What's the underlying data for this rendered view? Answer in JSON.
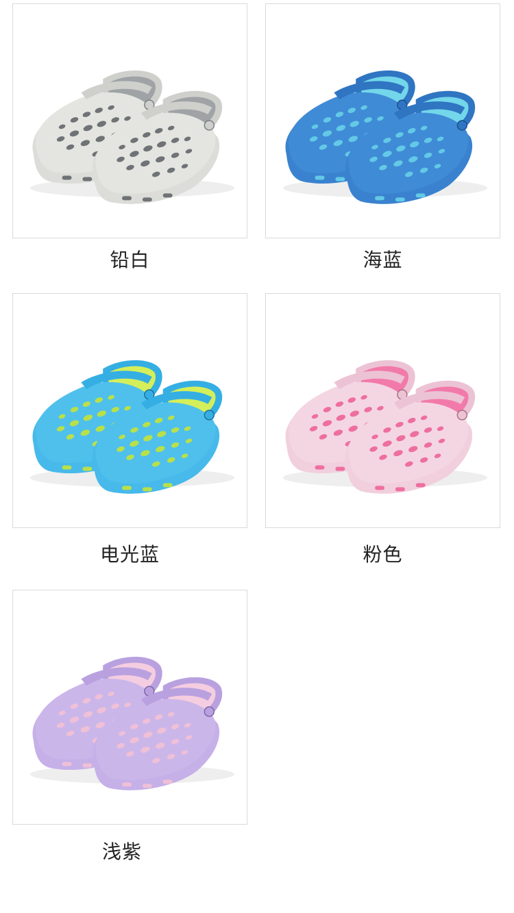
{
  "colors": [
    {
      "name": "铅白",
      "upper": "#e4e5e1",
      "upper_shade": "#cfd0cc",
      "sole": "#dcddd9",
      "inner": "#9fa3a5",
      "hole": "#6f7375",
      "logo": "#7a7f86"
    },
    {
      "name": "海蓝",
      "upper": "#3f8bd6",
      "upper_shade": "#2f75c2",
      "sole": "#3a82cf",
      "inner": "#74d6ea",
      "hole": "#63c9e6",
      "logo": "#1c4f8f"
    },
    {
      "name": "电光蓝",
      "upper": "#4fc0ec",
      "upper_shade": "#35afe3",
      "sole": "#47b9ea",
      "inner": "#d4ef5a",
      "hole": "#b9e04a",
      "logo": "#1f6f9d"
    },
    {
      "name": "粉色",
      "upper": "#f4d6e3",
      "upper_shade": "#ecc3d4",
      "sole": "#f1cfdc",
      "inner": "#f27aaa",
      "hole": "#ee6f9f",
      "logo": "#a87080"
    },
    {
      "name": "浅紫",
      "upper": "#cbb6ea",
      "upper_shade": "#b9a1e0",
      "sole": "#c6b0e8",
      "inner": "#f5cde0",
      "hole": "#efc0d6",
      "logo": "#7d64a8"
    }
  ]
}
